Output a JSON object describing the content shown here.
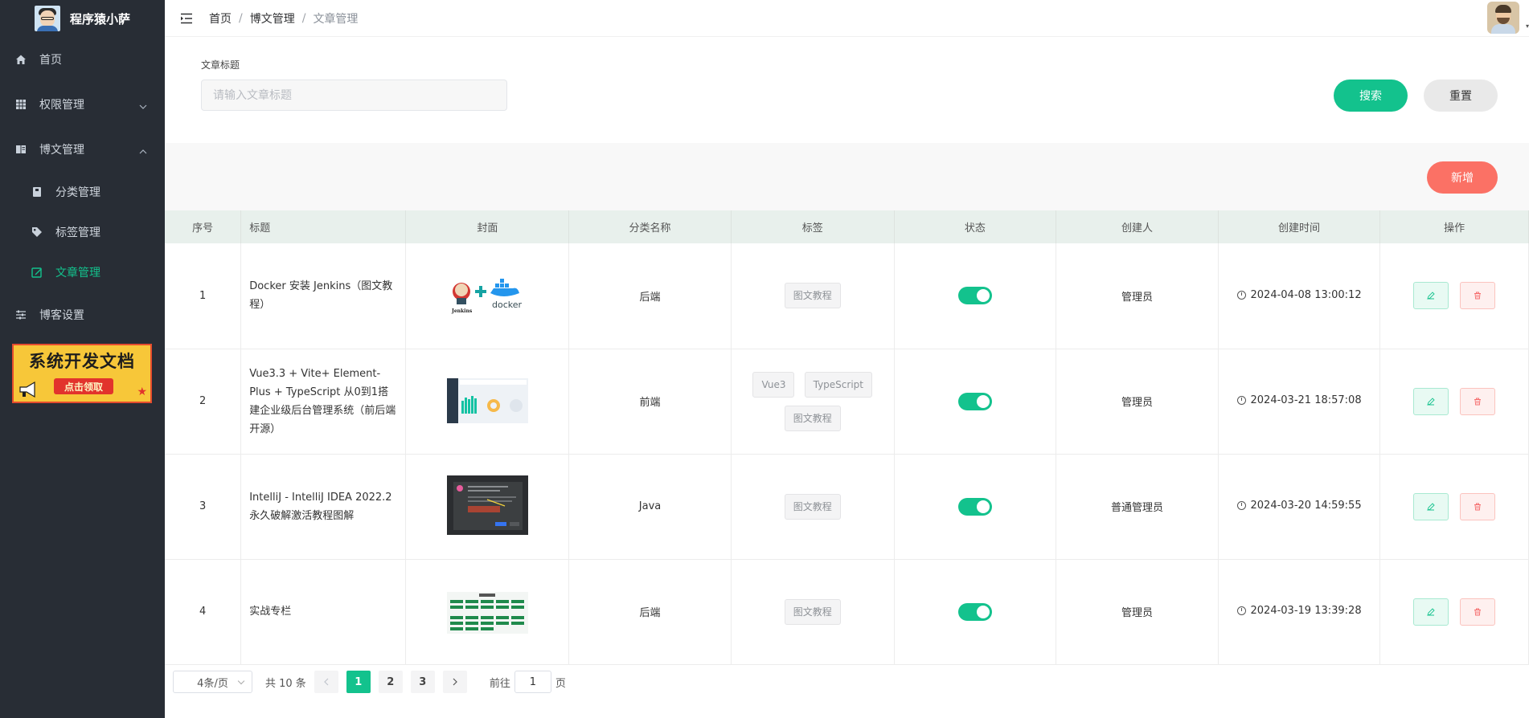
{
  "brand": {
    "name": "程序猿小萨"
  },
  "sidebar": {
    "items": [
      {
        "label": "首页",
        "icon": "home-icon"
      },
      {
        "label": "权限管理",
        "icon": "grid-icon",
        "expanded": false
      },
      {
        "label": "博文管理",
        "icon": "book-icon",
        "expanded": true,
        "children": [
          {
            "label": "分类管理",
            "icon": "folder-icon"
          },
          {
            "label": "标签管理",
            "icon": "tag-icon"
          },
          {
            "label": "文章管理",
            "icon": "edit-icon",
            "active": true
          }
        ]
      },
      {
        "label": "博客设置",
        "icon": "sliders-icon"
      }
    ],
    "promo": {
      "title": "系统开发文档",
      "button": "点击领取"
    }
  },
  "breadcrumb": [
    "首页",
    "博文管理",
    "文章管理"
  ],
  "search": {
    "label": "文章标题",
    "placeholder": "请输入文章标题",
    "search_button": "搜索",
    "reset_button": "重置"
  },
  "toolbar": {
    "add_button": "新增"
  },
  "table": {
    "columns": [
      "序号",
      "标题",
      "封面",
      "分类名称",
      "标签",
      "状态",
      "创建人",
      "创建时间",
      "操作"
    ],
    "rows": [
      {
        "index": "1",
        "title": "Docker 安装 Jenkins（图文教程）",
        "category": "后端",
        "tags": [
          "图文教程"
        ],
        "status": true,
        "creator": "管理员",
        "created": "2024-04-08 13:00:12"
      },
      {
        "index": "2",
        "title": "Vue3.3 + Vite+ Element-Plus + TypeScript 从0到1搭建企业级后台管理系统（前后端开源）",
        "category": "前端",
        "tags": [
          "Vue3",
          "TypeScript",
          "图文教程"
        ],
        "status": true,
        "creator": "管理员",
        "created": "2024-03-21 18:57:08"
      },
      {
        "index": "3",
        "title": "IntelliJ - IntelliJ IDEA 2022.2 永久破解激活教程图解",
        "category": "Java",
        "tags": [
          "图文教程"
        ],
        "status": true,
        "creator": "普通管理员",
        "created": "2024-03-20 14:59:55"
      },
      {
        "index": "4",
        "title": "实战专栏",
        "category": "后端",
        "tags": [
          "图文教程"
        ],
        "status": true,
        "creator": "管理员",
        "created": "2024-03-19 13:39:28"
      }
    ]
  },
  "pagination": {
    "page_size": "4条/页",
    "total": "共 10 条",
    "pages": [
      "1",
      "2",
      "3"
    ],
    "current": "1",
    "goto_prefix": "前往",
    "goto_value": "1",
    "goto_suffix": "页"
  },
  "colors": {
    "primary": "#13c28d",
    "danger": "#fb7165",
    "sidebar": "#282d35"
  }
}
